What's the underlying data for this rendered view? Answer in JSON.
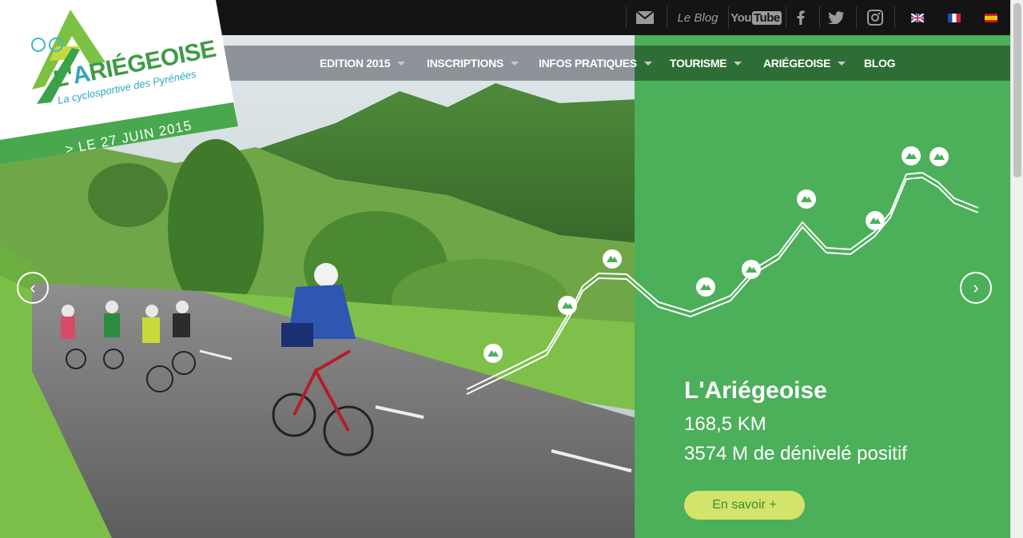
{
  "topbar": {
    "mail_icon": "mail-icon",
    "blog_label": "Le Blog",
    "youtube": {
      "you": "You",
      "tube": "Tube"
    },
    "facebook_icon": "facebook-icon",
    "twitter_icon": "twitter-icon",
    "instagram_icon": "instagram-icon",
    "languages": [
      "en-flag",
      "fr-flag",
      "es-flag"
    ]
  },
  "logo": {
    "name_prefix": "L'",
    "name_accent": "A",
    "name_rest": "RIÉGEOISE",
    "tagline": "La cyclosportive des Pyrénées",
    "date": "> LE 27 JUIN 2015"
  },
  "nav": {
    "items": [
      {
        "label": "EDITION 2015",
        "has_dropdown": true
      },
      {
        "label": "INSCRIPTIONS",
        "has_dropdown": true
      },
      {
        "label": "INFOS PRATIQUES",
        "has_dropdown": true
      },
      {
        "label": "TOURISME",
        "has_dropdown": true
      },
      {
        "label": "ARIÉGEOISE",
        "has_dropdown": true
      },
      {
        "label": "BLOG",
        "has_dropdown": false
      }
    ]
  },
  "slider": {
    "prev_label": "‹",
    "next_label": "›"
  },
  "route": {
    "title": "L'Ariégeoise",
    "distance": "168,5 KM",
    "elevation": "3574 M de dénivelé positif",
    "cta_label": "En savoir +"
  },
  "colors": {
    "green": "#4caf5a",
    "dark_green": "#2e6e36",
    "cta_yellow": "#d4e36a",
    "topbar": "#141414"
  }
}
